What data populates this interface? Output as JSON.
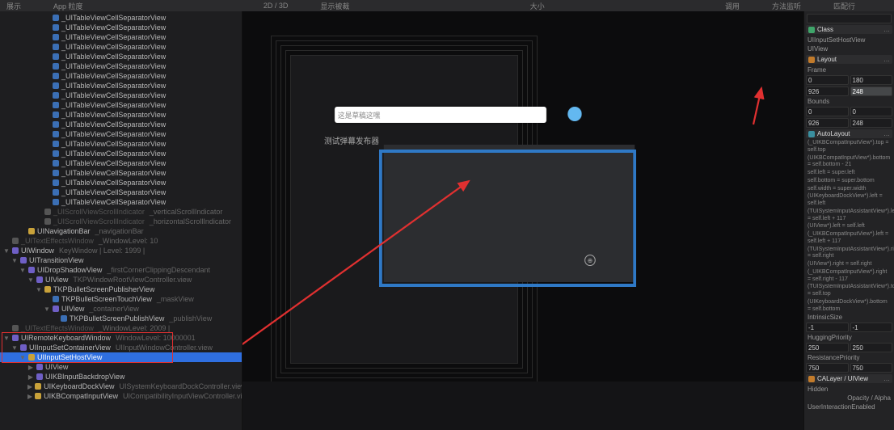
{
  "topbar": {
    "items": [
      "展示",
      "App 粒度",
      "",
      "2D / 3D",
      "显示被裁",
      "",
      "大小",
      "",
      "调用",
      "方法监听",
      "匹配行"
    ]
  },
  "tree": {
    "sep": "_UITableViewCellSeparatorView",
    "sepCount": 20,
    "extra": [
      {
        "cube": "gray",
        "name": "_UIScrollViewScrollIndicator",
        "note": "_verticalScrollIndicator",
        "dim": true,
        "ind": 4
      },
      {
        "cube": "gray",
        "name": "_UIScrollViewScrollIndicator",
        "note": "_horizontalScrollIndicator",
        "dim": true,
        "ind": 4
      },
      {
        "cube": "gold",
        "name": "UINavigationBar",
        "note": "_navigationBar",
        "ind": 2
      },
      {
        "cube": "gray",
        "name": "_UITextEffectsWindow",
        "note": "_WindowLevel: 10",
        "dim": true,
        "ind": 0
      },
      {
        "cube": "purple",
        "name": "UIWindow",
        "note": "KeyWindow | Level: 1999 |",
        "ind": 0,
        "arrow": "▼"
      },
      {
        "cube": "purple",
        "name": "UITransitionView",
        "ind": 1,
        "arrow": "▼"
      },
      {
        "cube": "purple",
        "name": "UIDropShadowView",
        "note": "_firstCornerClippingDescendant",
        "ind": 2,
        "arrow": "▼"
      },
      {
        "cube": "purple",
        "name": "UIView",
        "note": "TKPWindowRootViewController.view",
        "ind": 3,
        "arrow": "▼"
      },
      {
        "cube": "gold",
        "name": "TKPBulletScreenPublisherView",
        "ind": 4,
        "arrow": "▼"
      },
      {
        "cube": "blue",
        "name": "TKPBulletScreenTouchView",
        "note": "_maskView",
        "ind": 5
      },
      {
        "cube": "purple",
        "name": "UIView",
        "note": "_containerView",
        "ind": 5,
        "arrow": "▼"
      },
      {
        "cube": "blue",
        "name": "TKPBulletScreenPublishView",
        "note": "_publishView",
        "ind": 6
      },
      {
        "cube": "gray",
        "name": "_UITextEffectsWindow",
        "note": "_WindowLevel: 2009 |",
        "dim": true,
        "ind": 0
      }
    ],
    "boxed": [
      {
        "cube": "purple",
        "name": "UIRemoteKeyboardWindow",
        "note": "WindowLevel: 10000001",
        "ind": 0,
        "arrow": "▼"
      },
      {
        "cube": "purple",
        "name": "UIInputSetContainerView",
        "note": "UIInputWindowController.view",
        "ind": 1,
        "arrow": "▼"
      },
      {
        "cube": "gold",
        "name": "UIInputSetHostView",
        "ind": 2,
        "arrow": "▼",
        "sel": true
      }
    ],
    "after": [
      {
        "cube": "purple",
        "name": "UIView",
        "ind": 3,
        "arrow": "▶"
      },
      {
        "cube": "purple",
        "name": "UIKBInputBackdropView",
        "ind": 3,
        "arrow": "▶"
      },
      {
        "cube": "gold",
        "name": "UIKeyboardDockView",
        "note": "UISystemKeyboardDockController.view",
        "ind": 3,
        "arrow": "▶"
      },
      {
        "cube": "gold",
        "name": "UIKBCompatInputView",
        "note": "UICompatibilityInputViewController.view",
        "ind": 3,
        "arrow": "▶"
      }
    ]
  },
  "center": {
    "placeholder": "这是草稿这嘿",
    "subtitle": "测试弹幕发布器",
    "globe": "⊕"
  },
  "right": {
    "class": {
      "title": "Class",
      "name": "UIInputSetHostView",
      "sub": "UIView"
    },
    "layout": {
      "title": "Layout",
      "frame_label": "Frame",
      "frame": [
        "0",
        "180",
        "926",
        "248"
      ],
      "bounds_label": "Bounds",
      "bounds": [
        "0",
        "0",
        "926",
        "248"
      ]
    },
    "autolayout": {
      "title": "AutoLayout",
      "constraints": [
        "(_UIKBCompatInputView*).top = self.top",
        "(UIKBCompatInputView*).bottom = self.bottom - 21",
        "self.left = super.left",
        "self.bottom = super.bottom",
        "self.width = super.width",
        "(UIKeyboardDockView*).left = self.left",
        "(TUISystemInputAssistantView*).left = self.left + 117",
        "(UIView*).left = self.left",
        "(_UIKBCompatInputView*).left = self.left + 117",
        "(TUISystemInputAssistantView*).right = self.right",
        "(UIView*).right = self.right",
        "(_UIKBCompatInputView*).right = self.right - 117",
        "(TUISystemInputAssistantView*).top = self.top",
        "(UIKeyboardDockView*).bottom = self.bottom"
      ],
      "intr": "IntrinsicSize",
      "intrV": [
        "-1",
        "-1"
      ],
      "hug": "HuggingPriority",
      "hugV": [
        "250",
        "250"
      ],
      "res": "ResistancePriority",
      "resV": [
        "750",
        "750"
      ]
    },
    "calayer": {
      "title": "CALayer / UIView",
      "hidden": "Hidden",
      "opa": "Opacity / Alpha",
      "uie": "UserInteractionEnabled"
    }
  }
}
